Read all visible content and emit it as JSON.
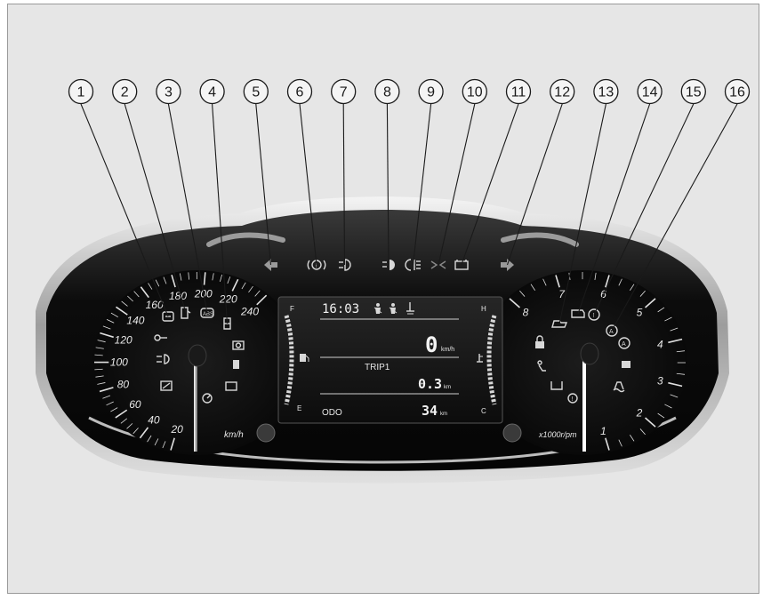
{
  "callouts": [
    {
      "num": "1",
      "target": "icon-1"
    },
    {
      "num": "2",
      "target": "icon-2"
    },
    {
      "num": "3",
      "target": "icon-3"
    },
    {
      "num": "4",
      "target": "icon-4"
    },
    {
      "num": "5",
      "target": "icon-5"
    },
    {
      "num": "6",
      "target": "icon-6"
    },
    {
      "num": "7",
      "target": "icon-7"
    },
    {
      "num": "8",
      "target": "icon-8"
    },
    {
      "num": "9",
      "target": "icon-9"
    },
    {
      "num": "10",
      "target": "icon-10"
    },
    {
      "num": "11",
      "target": "icon-11"
    },
    {
      "num": "12",
      "target": "icon-12"
    },
    {
      "num": "13",
      "target": "icon-13"
    },
    {
      "num": "14",
      "target": "icon-14"
    },
    {
      "num": "15",
      "target": "icon-15"
    },
    {
      "num": "16",
      "target": "icon-16"
    }
  ],
  "speedometer": {
    "labels": [
      "20",
      "40",
      "60",
      "80",
      "100",
      "120",
      "140",
      "160",
      "180",
      "200",
      "220",
      "240"
    ],
    "unit": "km/h"
  },
  "tachometer": {
    "labels": [
      "1",
      "2",
      "3",
      "4",
      "5",
      "6",
      "7",
      "8"
    ],
    "unit": "x1000r/pm"
  },
  "display": {
    "time": "16:03",
    "fuel_full": "F",
    "fuel_empty": "E",
    "temp_hot": "H",
    "temp_cold": "C",
    "speed_value": "0",
    "speed_unit": "km/h",
    "trip_label": "TRIP1",
    "trip_value": "0.3",
    "trip_unit": "km",
    "odo_label": "ODO",
    "odo_value": "34",
    "odo_unit": "km"
  },
  "colors": {
    "background": "#e6e6e6",
    "cluster": "#121212",
    "chrome": "#c8c8c8",
    "lcd": "#141414",
    "needle": "#ffffff"
  }
}
